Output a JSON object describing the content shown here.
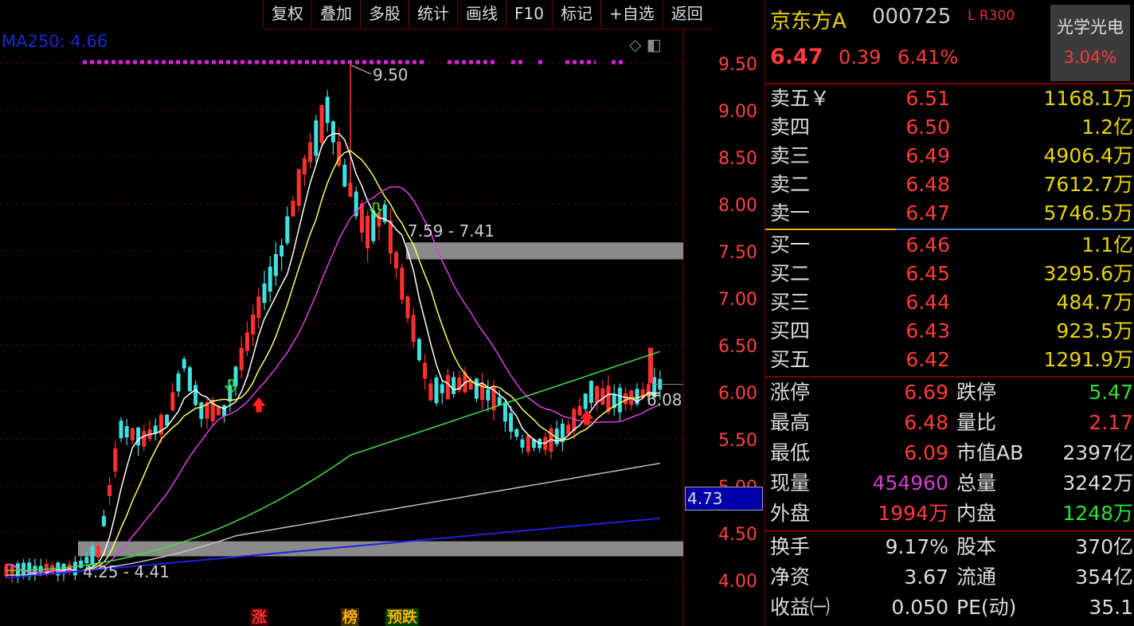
{
  "toolbar": {
    "buttons": [
      "复权",
      "叠加",
      "多股",
      "统计",
      "画线",
      "F10",
      "标记",
      "+自选",
      "返回"
    ]
  },
  "chart_header": {
    "ma_label": "MA250: 4.66"
  },
  "chart_data": {
    "type": "candlestick",
    "y_axis_ticks": [
      "9.50",
      "9.00",
      "8.50",
      "8.00",
      "7.50",
      "7.00",
      "6.50",
      "6.00",
      "5.50",
      "5.00",
      "4.50",
      "4.00"
    ],
    "ylim": [
      3.95,
      9.95
    ],
    "annotations": {
      "high_marker": "9.50",
      "zone_upper": "7.59 - 7.41",
      "zone_lower": "4.25 - 4.41",
      "last_close_label": "6.08",
      "current_price_tag": "4.73"
    },
    "zones": [
      {
        "low": 7.41,
        "high": 7.59
      },
      {
        "low": 4.25,
        "high": 4.41
      }
    ],
    "signal_labels": [
      "涨",
      "榜",
      "预跌"
    ],
    "colors": {
      "up": "#ff3030",
      "down": "#40e0e0",
      "ma5": "#ffffff",
      "ma10": "#ffff60",
      "ma20": "#e040e0",
      "ma60": "#40e040",
      "ma120": "#c0c0c0",
      "ma250": "#2020e0"
    }
  },
  "quote": {
    "name": "京东方A",
    "code": "000725",
    "flags": "L R300",
    "price": "6.47",
    "change": "0.39",
    "change_pct": "6.41%",
    "sector_name": "光学光电",
    "sector_pct": "3.04%"
  },
  "order_book": {
    "asks": [
      {
        "label": "卖五￥",
        "price": "6.51",
        "volume": "1168.1万"
      },
      {
        "label": "卖四",
        "price": "6.50",
        "volume": "1.2亿"
      },
      {
        "label": "卖三",
        "price": "6.49",
        "volume": "4906.4万"
      },
      {
        "label": "卖二",
        "price": "6.48",
        "volume": "7612.7万"
      },
      {
        "label": "卖一",
        "price": "6.47",
        "volume": "5746.5万"
      }
    ],
    "bids": [
      {
        "label": "买一",
        "price": "6.46",
        "volume": "1.1亿"
      },
      {
        "label": "买二",
        "price": "6.45",
        "volume": "3295.6万"
      },
      {
        "label": "买三",
        "price": "6.44",
        "volume": "484.7万"
      },
      {
        "label": "买四",
        "price": "6.43",
        "volume": "923.5万"
      },
      {
        "label": "买五",
        "price": "6.42",
        "volume": "1291.9万"
      }
    ]
  },
  "stats": [
    {
      "l": "涨停",
      "lv": "6.69",
      "lc": "#ff3a3a",
      "r": "跌停",
      "rv": "5.47",
      "rc": "#30e030"
    },
    {
      "l": "最高",
      "lv": "6.48",
      "lc": "#ff3a3a",
      "r": "量比",
      "rv": "2.17",
      "rc": "#ff3a3a"
    },
    {
      "l": "最低",
      "lv": "6.09",
      "lc": "#ff3a3a",
      "r": "市值AB",
      "rv": "2397亿",
      "rc": "#ddd"
    },
    {
      "l": "现量",
      "lv": "454960",
      "lc": "#d040d0",
      "r": "总量",
      "rv": "3242万",
      "rc": "#ddd"
    },
    {
      "l": "外盘",
      "lv": "1994万",
      "lc": "#ff3a3a",
      "r": "内盘",
      "rv": "1248万",
      "rc": "#30e030"
    }
  ],
  "stats2": [
    {
      "l": "换手",
      "lv": "9.17%",
      "lc": "#ddd",
      "r": "股本",
      "rv": "370亿",
      "rc": "#ddd"
    },
    {
      "l": "净资",
      "lv": "3.67",
      "lc": "#ddd",
      "r": "流通",
      "rv": "354亿",
      "rc": "#ddd"
    },
    {
      "l": "收益㈠",
      "lv": "0.050",
      "lc": "#ddd",
      "r": "PE(动)",
      "rv": "35.1",
      "rc": "#ddd"
    }
  ]
}
